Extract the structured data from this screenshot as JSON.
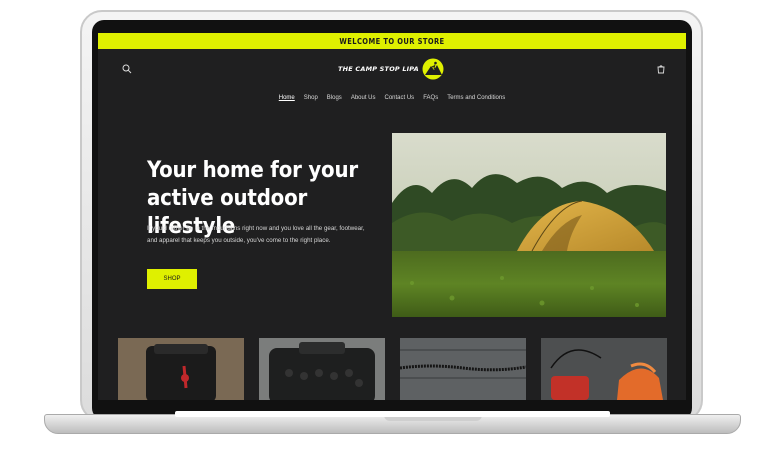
{
  "announcement": {
    "text": "WELCOME TO OUR STORE"
  },
  "logo": {
    "text": "THE CAMP STOP LIPA"
  },
  "nav": {
    "items": [
      {
        "label": "Home",
        "active": true
      },
      {
        "label": "Shop",
        "active": false
      },
      {
        "label": "Blogs",
        "active": false
      },
      {
        "label": "About Us",
        "active": false
      },
      {
        "label": "Contact Us",
        "active": false
      },
      {
        "label": "FAQs",
        "active": false
      },
      {
        "label": "Terms and Conditions",
        "active": false
      }
    ]
  },
  "hero": {
    "title": "Your home for your active outdoor lifestyle",
    "text": "If you'd rather be in the mountains right now and you love all the gear, footwear, and apparel that keeps you outside, you've come to the right place.",
    "button_label": "SHOP"
  },
  "icons": {
    "search": "search-icon",
    "cart": "cart-icon",
    "logo": "mountain-climber-icon"
  },
  "colors": {
    "accent": "#dff000",
    "background": "#1f1f20"
  }
}
